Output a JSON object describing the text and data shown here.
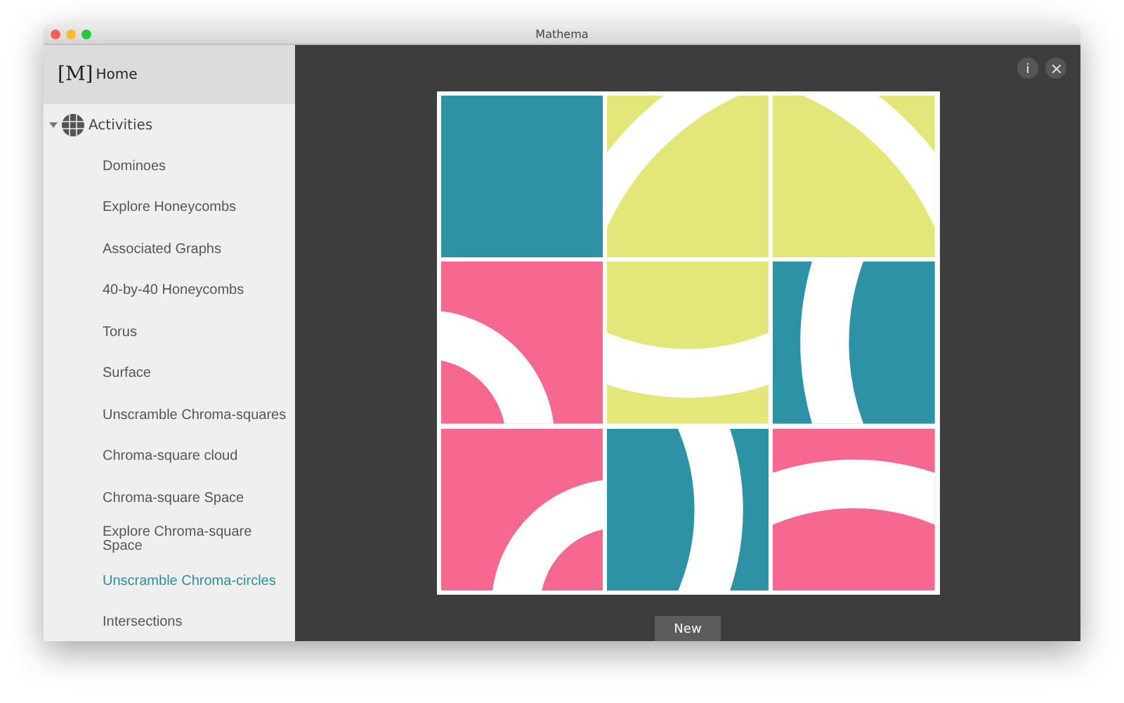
{
  "window": {
    "title": "Mathema"
  },
  "sidebar": {
    "home": {
      "logo": "[M]",
      "label": "Home"
    },
    "section": {
      "label": "Activities",
      "expanded": true
    },
    "items": [
      {
        "label": "Dominoes",
        "selected": false
      },
      {
        "label": "Explore Honeycombs",
        "selected": false
      },
      {
        "label": "Associated Graphs",
        "selected": false
      },
      {
        "label": "40-by-40 Honeycombs",
        "selected": false
      },
      {
        "label": "Torus",
        "selected": false
      },
      {
        "label": "Surface",
        "selected": false
      },
      {
        "label": "Unscramble Chroma-squares",
        "selected": false
      },
      {
        "label": "Chroma-square cloud",
        "selected": false
      },
      {
        "label": "Chroma-square Space",
        "selected": false
      },
      {
        "label": "Explore Chroma-square Space",
        "selected": false
      },
      {
        "label": "Unscramble Chroma-circles",
        "selected": true
      },
      {
        "label": "Intersections",
        "selected": false
      }
    ]
  },
  "puzzle": {
    "tiles": [
      {
        "kind": "plain",
        "color": "#2e92a6"
      },
      {
        "kind": "arc",
        "color": "#e3e77a"
      },
      {
        "kind": "arc",
        "color": "#e3e77a"
      },
      {
        "kind": "arc",
        "color": "#f6688f"
      },
      {
        "kind": "arc",
        "color": "#e3e77a"
      },
      {
        "kind": "arc",
        "color": "#2e92a6"
      },
      {
        "kind": "arc",
        "color": "#f6688f"
      },
      {
        "kind": "arc",
        "color": "#2e92a6"
      },
      {
        "kind": "arc",
        "color": "#f6688f"
      }
    ]
  },
  "new_button": "New"
}
